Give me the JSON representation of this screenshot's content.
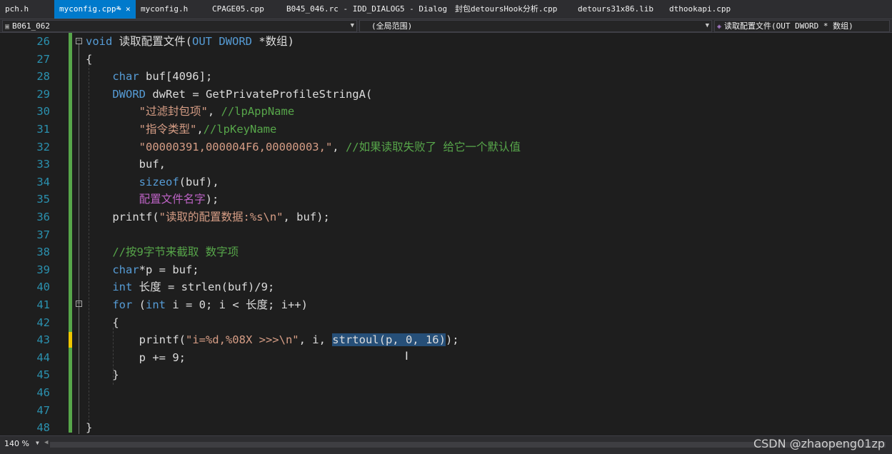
{
  "tabs": [
    {
      "label": "pch.h",
      "active": false
    },
    {
      "label": "myconfig.cpp*",
      "active": true
    },
    {
      "label": "myconfig.h",
      "active": false
    },
    {
      "label": "CPAGE05.cpp",
      "active": false
    },
    {
      "label": "B045_046.rc - IDD_DIALOG5 - Dialog",
      "active": false
    },
    {
      "label": "封包detoursHook分析.cpp",
      "active": false
    },
    {
      "label": "detours31x86.lib",
      "active": false
    },
    {
      "label": "dthookapi.cpp",
      "active": false
    }
  ],
  "tab_icons": {
    "pin": "pin-icon",
    "close": "close-icon"
  },
  "navbar": {
    "project": "B061_062",
    "scope": "(全局范围)",
    "member": "读取配置文件(OUT DWORD * 数组)",
    "member_icon": "function-icon"
  },
  "editor": {
    "lines": [
      {
        "num": "26",
        "tokens": [
          [
            "kw",
            "void"
          ],
          [
            "pl",
            " 读取配置文件("
          ],
          [
            "kw",
            "OUT"
          ],
          [
            "pl",
            " "
          ],
          [
            "kw",
            "DWORD"
          ],
          [
            "pl",
            " *数组)"
          ]
        ]
      },
      {
        "num": "27",
        "tokens": [
          [
            "pl",
            "{"
          ]
        ]
      },
      {
        "num": "28",
        "tokens": [
          [
            "pl",
            "    "
          ],
          [
            "kw",
            "char"
          ],
          [
            "pl",
            " buf[4096];"
          ]
        ]
      },
      {
        "num": "29",
        "tokens": [
          [
            "pl",
            "    "
          ],
          [
            "kw",
            "DWORD"
          ],
          [
            "pl",
            " dwRet = GetPrivateProfileStringA("
          ]
        ]
      },
      {
        "num": "30",
        "tokens": [
          [
            "pl",
            "        "
          ],
          [
            "str",
            "\"过滤封包项\""
          ],
          [
            "pl",
            ", "
          ],
          [
            "cm",
            "//lpAppName"
          ]
        ]
      },
      {
        "num": "31",
        "tokens": [
          [
            "pl",
            "        "
          ],
          [
            "str",
            "\"指令类型\""
          ],
          [
            "pl",
            ","
          ],
          [
            "cm",
            "//lpKeyName"
          ]
        ]
      },
      {
        "num": "32",
        "tokens": [
          [
            "pl",
            "        "
          ],
          [
            "str",
            "\"00000391,000004F6,00000003,\""
          ],
          [
            "pl",
            ", "
          ],
          [
            "cm",
            "//如果读取失败了 给它一个默认值"
          ]
        ]
      },
      {
        "num": "33",
        "tokens": [
          [
            "pl",
            "        buf,"
          ]
        ]
      },
      {
        "num": "34",
        "tokens": [
          [
            "pl",
            "        "
          ],
          [
            "kw",
            "sizeof"
          ],
          [
            "pl",
            "(buf),"
          ]
        ]
      },
      {
        "num": "35",
        "tokens": [
          [
            "pl",
            "        "
          ],
          [
            "mac",
            "配置文件名字"
          ],
          [
            "pl",
            ");"
          ]
        ]
      },
      {
        "num": "36",
        "tokens": [
          [
            "pl",
            "    printf("
          ],
          [
            "str",
            "\"读取的配置数据:%s\\n\""
          ],
          [
            "pl",
            ", buf);"
          ]
        ]
      },
      {
        "num": "37",
        "tokens": []
      },
      {
        "num": "38",
        "tokens": [
          [
            "pl",
            "    "
          ],
          [
            "cm",
            "//按9字节来截取 数字项"
          ]
        ]
      },
      {
        "num": "39",
        "tokens": [
          [
            "pl",
            "    "
          ],
          [
            "kw",
            "char"
          ],
          [
            "pl",
            "*p = buf;"
          ]
        ]
      },
      {
        "num": "40",
        "tokens": [
          [
            "pl",
            "    "
          ],
          [
            "kw",
            "int"
          ],
          [
            "pl",
            " 长度 = strlen(buf)/9;"
          ]
        ]
      },
      {
        "num": "41",
        "tokens": [
          [
            "pl",
            "    "
          ],
          [
            "kw",
            "for"
          ],
          [
            "pl",
            " ("
          ],
          [
            "kw",
            "int"
          ],
          [
            "pl",
            " i = 0; i < 长度; i++)"
          ]
        ]
      },
      {
        "num": "42",
        "tokens": [
          [
            "pl",
            "    {"
          ]
        ]
      },
      {
        "num": "43",
        "tokens": [
          [
            "pl",
            "        printf("
          ],
          [
            "str",
            "\"i=%d,%08X >>>\\n\""
          ],
          [
            "pl",
            ", i, "
          ],
          [
            "sel",
            "strtoul(p, 0, 16)"
          ],
          [
            "pl",
            ");"
          ]
        ]
      },
      {
        "num": "44",
        "tokens": [
          [
            "pl",
            "        p += 9;"
          ]
        ]
      },
      {
        "num": "45",
        "tokens": [
          [
            "pl",
            "    }"
          ]
        ]
      },
      {
        "num": "46",
        "tokens": []
      },
      {
        "num": "47",
        "tokens": []
      },
      {
        "num": "48",
        "tokens": [
          [
            "pl",
            "}"
          ]
        ]
      }
    ]
  },
  "statusbar": {
    "zoom": "140 %"
  },
  "watermark": "CSDN @zhaopeng01zp"
}
